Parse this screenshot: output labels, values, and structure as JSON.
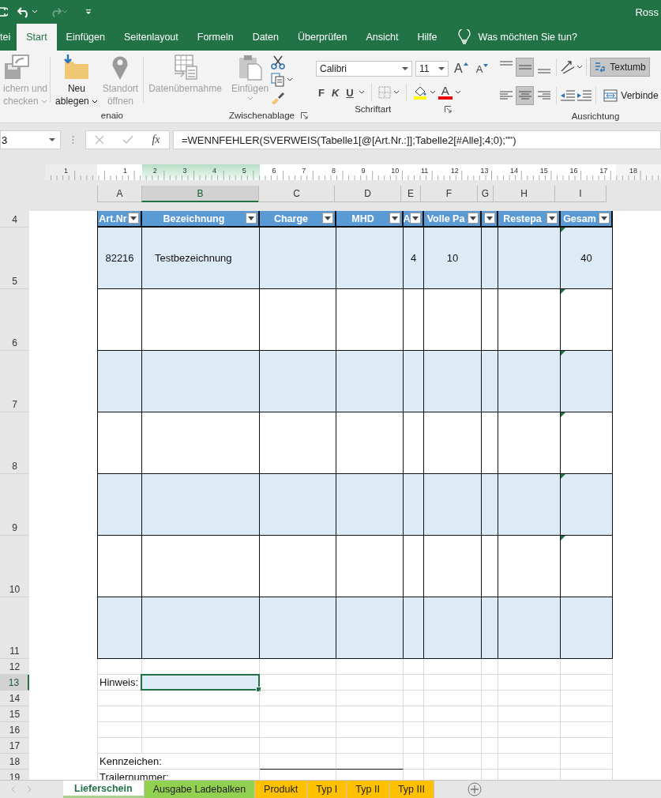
{
  "title_bar": {
    "user": "Ross",
    "redo_disabled": true
  },
  "ribbon_tabs": [
    {
      "label": "tei",
      "selected": false
    },
    {
      "label": "Start",
      "selected": true
    },
    {
      "label": "Einfügen",
      "selected": false
    },
    {
      "label": "Seitenlayout",
      "selected": false
    },
    {
      "label": "Formeln",
      "selected": false
    },
    {
      "label": "Daten",
      "selected": false
    },
    {
      "label": "Überprüfen",
      "selected": false
    },
    {
      "label": "Ansicht",
      "selected": false
    },
    {
      "label": "Hilfe",
      "selected": false
    }
  ],
  "tell_me": {
    "placeholder": "Was möchten Sie tun?"
  },
  "enaio_group": {
    "label": "enaio",
    "buttons": [
      {
        "kind": "save",
        "label": "ichern und\nchecken",
        "disabled": true,
        "menu": true
      },
      {
        "kind": "folder",
        "label": "Neu\nablegen",
        "disabled": false,
        "menu": true
      },
      {
        "kind": "pin",
        "label": "Standort\nöffnen",
        "disabled": true,
        "menu": false
      },
      {
        "kind": "table",
        "label": "Datenübernahme",
        "disabled": true,
        "menu": false
      }
    ]
  },
  "clipboard_group": {
    "label": "Zwischenablage",
    "paste": {
      "label": "Einfügen",
      "disabled": true
    }
  },
  "font_group": {
    "label": "Schriftart",
    "font": "Calibri",
    "size": "11",
    "grow": "A",
    "shrink": "A",
    "bold": "F",
    "italic": "K",
    "underline": "U",
    "font_color": "A"
  },
  "alignment_group": {
    "label": "Ausrichtung",
    "align_buttons": [
      {
        "kind": "top",
        "selected": false
      },
      {
        "kind": "middle",
        "selected": true
      },
      {
        "kind": "bottom",
        "selected": false
      },
      {
        "kind": "left",
        "selected": false
      },
      {
        "kind": "center",
        "selected": true
      },
      {
        "kind": "right",
        "selected": false
      }
    ],
    "wrap": {
      "label": "Textumb",
      "selected": true
    },
    "merge": {
      "label": "Verbinde"
    }
  },
  "formula_bar": {
    "name_box": "3",
    "fx": "fx",
    "formula": "=WENNFEHLER(SVERWEIS(Tabelle1[@[Art.Nr.:]];Tabelle2[#Alle];4;0);\"\")"
  },
  "ruler": {
    "labels": [
      "1",
      "1",
      "2",
      "3",
      "4",
      "5",
      "6",
      "7",
      "8",
      "9",
      "10",
      "11",
      "12",
      "13",
      "14",
      "15",
      "16",
      "17",
      "18"
    ]
  },
  "column_headers": [
    {
      "label": "A",
      "selected": false
    },
    {
      "label": "B",
      "selected": true
    },
    {
      "label": "C",
      "selected": false
    },
    {
      "label": "D",
      "selected": false
    },
    {
      "label": "E",
      "selected": false
    },
    {
      "label": "F",
      "selected": false
    },
    {
      "label": "G",
      "selected": false
    },
    {
      "label": "H",
      "selected": false
    },
    {
      "label": "I",
      "selected": false
    }
  ],
  "sheet": {
    "header_row": {
      "number": "4",
      "columns": [
        {
          "label": "Art.Nr"
        },
        {
          "label": "Bezeichnung"
        },
        {
          "label": "Charge"
        },
        {
          "label": "MHD"
        },
        {
          "label": "A"
        },
        {
          "label": "Volle Pa"
        },
        {},
        {
          "label": "Restepa"
        },
        {
          "label": "Gesam"
        }
      ]
    },
    "rows": [
      {
        "number": "5",
        "cells": [
          "82216",
          "Testbezeichnung",
          null,
          null,
          "4",
          "10",
          null,
          null,
          "40"
        ],
        "error_marker": true
      },
      {
        "number": "6",
        "cells": [
          null,
          null,
          null,
          null,
          null,
          null,
          null,
          null,
          null
        ],
        "error_marker": true
      },
      {
        "number": "7",
        "cells": [
          null,
          null,
          null,
          null,
          null,
          null,
          null,
          null,
          null
        ],
        "error_marker": true
      },
      {
        "number": "8",
        "cells": [
          null,
          null,
          null,
          null,
          null,
          null,
          null,
          null,
          null
        ],
        "error_marker": true
      },
      {
        "number": "9",
        "cells": [
          null,
          null,
          null,
          null,
          null,
          null,
          null,
          null,
          null
        ],
        "error_marker": true
      },
      {
        "number": "10",
        "cells": [
          null,
          null,
          null,
          null,
          null,
          null,
          null,
          null,
          null
        ],
        "error_marker": true
      },
      {
        "number": "11",
        "cells": [
          null,
          null,
          null,
          null,
          null,
          null,
          null,
          null,
          null
        ],
        "error_marker": false
      }
    ],
    "lower_rows": [
      {
        "number": "12",
        "selected": false
      },
      {
        "number": "13",
        "selected": true,
        "label": "Hinweis:"
      },
      {
        "number": "14",
        "selected": false
      },
      {
        "number": "15",
        "selected": false
      },
      {
        "number": "16",
        "selected": false
      },
      {
        "number": "17",
        "selected": false
      },
      {
        "number": "18",
        "selected": false,
        "label": "Kennzeichen:",
        "wide": true,
        "underline": true
      },
      {
        "number": "19",
        "selected": false,
        "label": "Trailernummer:",
        "wide": true
      }
    ]
  },
  "sheet_tabs": [
    {
      "label": "Lieferschein",
      "selected": true
    },
    {
      "label": "Ausgabe Ladebalken",
      "selected": false,
      "color": "#92d050"
    },
    {
      "label": "Produkt",
      "selected": false,
      "color": "#ffc000"
    },
    {
      "label": "Typ I",
      "selected": false,
      "color": "#ffc000"
    },
    {
      "label": "Typ II",
      "selected": false,
      "color": "#ffc000"
    },
    {
      "label": "Typ III",
      "selected": false,
      "color": "#ffc000"
    }
  ]
}
